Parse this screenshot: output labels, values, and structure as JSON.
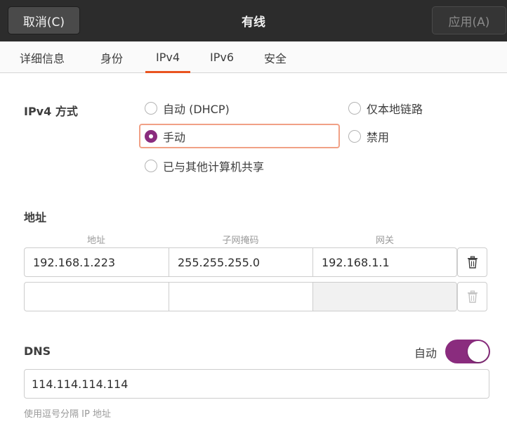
{
  "header": {
    "cancel_label": "取消(C)",
    "title": "有线",
    "apply_label": "应用(A)"
  },
  "tabs": [
    {
      "label": "详细信息"
    },
    {
      "label": "身份"
    },
    {
      "label": "IPv4",
      "active": true
    },
    {
      "label": "IPv6"
    },
    {
      "label": "安全"
    }
  ],
  "method": {
    "label": "IPv4 方式",
    "options": [
      {
        "label": "自动 (DHCP)",
        "checked": false
      },
      {
        "label": "仅本地链路",
        "checked": false
      },
      {
        "label": "手动",
        "checked": true
      },
      {
        "label": "禁用",
        "checked": false
      },
      {
        "label": "已与其他计算机共享",
        "checked": false
      }
    ]
  },
  "addresses": {
    "label": "地址",
    "columns": [
      "地址",
      "子网掩码",
      "网关"
    ],
    "rows": [
      [
        "192.168.1.223",
        "255.255.255.0",
        "192.168.1.1"
      ],
      [
        "",
        "",
        ""
      ]
    ]
  },
  "dns": {
    "label": "DNS",
    "auto_label": "自动",
    "auto_enabled": true,
    "value": "114.114.114.114",
    "hint": "使用逗号分隔 IP 地址"
  },
  "colors": {
    "accent": "#e95420",
    "selected": "#8a2c7e",
    "header_bg": "#2c2c2c"
  }
}
